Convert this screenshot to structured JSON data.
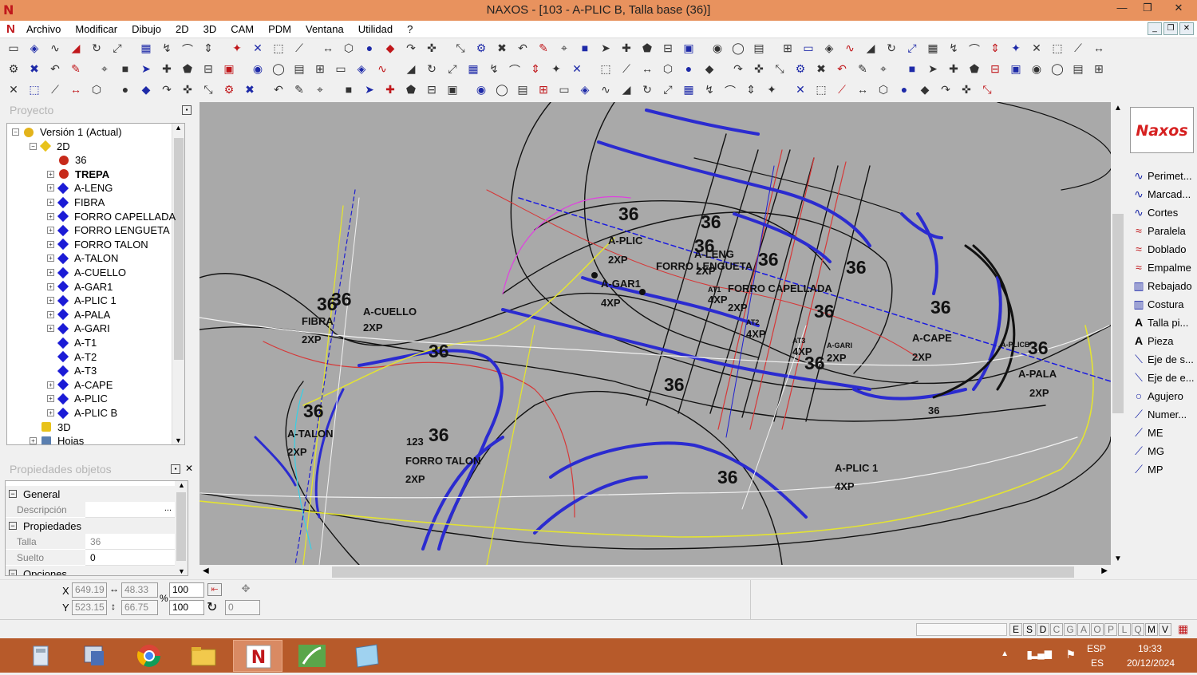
{
  "window": {
    "title": "NAXOS - [103 - A-PLIC B, Talla base (36)]",
    "app_icon": "N",
    "minimize": "—",
    "restore": "❐",
    "close": "✕"
  },
  "menu": {
    "items": [
      "Archivo",
      "Modificar",
      "Dibujo",
      "2D",
      "3D",
      "CAM",
      "PDM",
      "Ventana",
      "Utilidad",
      "?"
    ]
  },
  "project_panel": {
    "title": "Proyecto",
    "tree": [
      {
        "label": "Versión 1 (Actual)",
        "level": 0,
        "icon": "version-icon",
        "exp": "−"
      },
      {
        "label": "2D",
        "level": 1,
        "icon": "2d-icon",
        "exp": "−"
      },
      {
        "label": "36",
        "level": 2,
        "icon": "size-dot",
        "exp": ""
      },
      {
        "label": "TREPA",
        "level": 2,
        "icon": "size-dot",
        "exp": "+",
        "bold": true
      },
      {
        "label": "A-LENG",
        "level": 2,
        "icon": "piece",
        "exp": "+"
      },
      {
        "label": "FIBRA",
        "level": 2,
        "icon": "piece",
        "exp": "+"
      },
      {
        "label": "FORRO CAPELLADA",
        "level": 2,
        "icon": "piece",
        "exp": "+"
      },
      {
        "label": "FORRO LENGUETA",
        "level": 2,
        "icon": "piece",
        "exp": "+"
      },
      {
        "label": "FORRO TALON",
        "level": 2,
        "icon": "piece",
        "exp": "+"
      },
      {
        "label": "A-TALON",
        "level": 2,
        "icon": "piece",
        "exp": "+"
      },
      {
        "label": "A-CUELLO",
        "level": 2,
        "icon": "piece",
        "exp": "+"
      },
      {
        "label": "A-GAR1",
        "level": 2,
        "icon": "piece",
        "exp": "+"
      },
      {
        "label": "A-PLIC 1",
        "level": 2,
        "icon": "piece",
        "exp": "+"
      },
      {
        "label": "A-PALA",
        "level": 2,
        "icon": "piece",
        "exp": "+"
      },
      {
        "label": "A-GARI",
        "level": 2,
        "icon": "piece",
        "exp": "+"
      },
      {
        "label": "A-T1",
        "level": 2,
        "icon": "piece",
        "exp": ""
      },
      {
        "label": "A-T2",
        "level": 2,
        "icon": "piece",
        "exp": ""
      },
      {
        "label": "A-T3",
        "level": 2,
        "icon": "piece",
        "exp": ""
      },
      {
        "label": "A-CAPE",
        "level": 2,
        "icon": "piece",
        "exp": "+"
      },
      {
        "label": "A-PLIC",
        "level": 2,
        "icon": "piece",
        "exp": "+"
      },
      {
        "label": "A-PLIC B",
        "level": 2,
        "icon": "piece",
        "exp": "+"
      },
      {
        "label": "3D",
        "level": 1,
        "icon": "3d-icon",
        "exp": ""
      },
      {
        "label": "Hojas",
        "level": 1,
        "icon": "sheets-icon",
        "exp": "+"
      }
    ]
  },
  "props_panel": {
    "title": "Propiedades objetos",
    "sections": {
      "general": "General",
      "descripcion_label": "Descripción",
      "descripcion_value": "",
      "propiedades": "Propiedades",
      "talla_label": "Talla",
      "talla_value": "36",
      "suelto_label": "Suelto",
      "suelto_value": "0",
      "opciones": "Opciones"
    }
  },
  "coords": {
    "x_label": "X",
    "y_label": "Y",
    "x": "649.19",
    "y": "523.15",
    "w": "48.33",
    "h": "66.75",
    "scale1": "100",
    "scale2": "100",
    "pct": "%",
    "angle": "0"
  },
  "status": {
    "letters": [
      "E",
      "S",
      "D",
      "C",
      "G",
      "A",
      "O",
      "P",
      "L",
      "Q",
      "M",
      "V"
    ],
    "active": [
      "E",
      "S",
      "D",
      "M",
      "V"
    ]
  },
  "right_tools": [
    {
      "label": "Perimet...",
      "icon": "curve-icon"
    },
    {
      "label": "Marcad...",
      "icon": "curve-icon"
    },
    {
      "label": "Cortes",
      "icon": "curve-icon"
    },
    {
      "label": "Paralela",
      "icon": "parallel-icon"
    },
    {
      "label": "Doblado",
      "icon": "fold-icon"
    },
    {
      "label": "Empalme",
      "icon": "join-icon"
    },
    {
      "label": "Rebajado",
      "icon": "skive-icon"
    },
    {
      "label": "Costura",
      "icon": "seam-icon"
    },
    {
      "label": "Talla pi...",
      "icon": "text-a-icon"
    },
    {
      "label": "Pieza",
      "icon": "text-a-icon"
    },
    {
      "label": "Eje de s...",
      "icon": "axis-icon"
    },
    {
      "label": "Eje de e...",
      "icon": "axis-icon"
    },
    {
      "label": "Agujero",
      "icon": "hole-icon"
    },
    {
      "label": "Numer...",
      "icon": "number-icon"
    },
    {
      "label": "ME",
      "icon": "mark-icon"
    },
    {
      "label": "MG",
      "icon": "mark-icon"
    },
    {
      "label": "MP",
      "icon": "mark-icon"
    }
  ],
  "canvas_labels": [
    {
      "t": "36",
      "big": true
    },
    {
      "t": "36",
      "big": true
    },
    {
      "t": "36",
      "big": true
    },
    {
      "t": "36",
      "big": true
    },
    {
      "t": "A-PLIC"
    },
    {
      "t": "2XP"
    },
    {
      "t": "A-LENG"
    },
    {
      "t": "2XP"
    },
    {
      "t": "FORRO LENGUETA"
    },
    {
      "t": "A-GAR1"
    },
    {
      "t": "4XP"
    },
    {
      "t": "AT1"
    },
    {
      "t": "4XP"
    },
    {
      "t": "FORRO CAPELLADA"
    },
    {
      "t": "2XP"
    },
    {
      "t": "AT2"
    },
    {
      "t": "4XP"
    },
    {
      "t": "AT3"
    },
    {
      "t": "4XP"
    },
    {
      "t": "A-GARI"
    },
    {
      "t": "2XP"
    },
    {
      "t": "A-CAPE"
    },
    {
      "t": "2XP"
    },
    {
      "t": "A-PALA"
    },
    {
      "t": "2XP"
    },
    {
      "t": "A-CUELLO"
    },
    {
      "t": "2XP"
    },
    {
      "t": "FIBRA"
    },
    {
      "t": "2XP"
    },
    {
      "t": "A-TALON"
    },
    {
      "t": "2XP"
    },
    {
      "t": "123"
    },
    {
      "t": "FORRO TALON"
    },
    {
      "t": "2XP"
    },
    {
      "t": "A-PLIC 1"
    },
    {
      "t": "4XP"
    },
    {
      "t": "A-PLICB"
    },
    {
      "t": "36",
      "big": true
    },
    {
      "t": "36",
      "big": true
    },
    {
      "t": "36",
      "big": true
    },
    {
      "t": "36",
      "big": true
    },
    {
      "t": "36",
      "big": true
    },
    {
      "t": "36",
      "big": true
    },
    {
      "t": "36",
      "big": true
    },
    {
      "t": "36",
      "big": true
    },
    {
      "t": "36",
      "big": true
    },
    {
      "t": "36",
      "big": true
    },
    {
      "t": "36",
      "big": true
    },
    {
      "t": "36",
      "big": true
    },
    {
      "t": "36"
    }
  ],
  "tray": {
    "lang1": "ESP",
    "lang2": "ES",
    "time": "19:33",
    "date": "20/12/2024"
  },
  "logo": "Naxos",
  "colors": {
    "titlebar": "#e8925e",
    "taskbar": "#b75a2a",
    "canvas": "#a9a9a9",
    "piece_blue": "#2b2bd0"
  }
}
